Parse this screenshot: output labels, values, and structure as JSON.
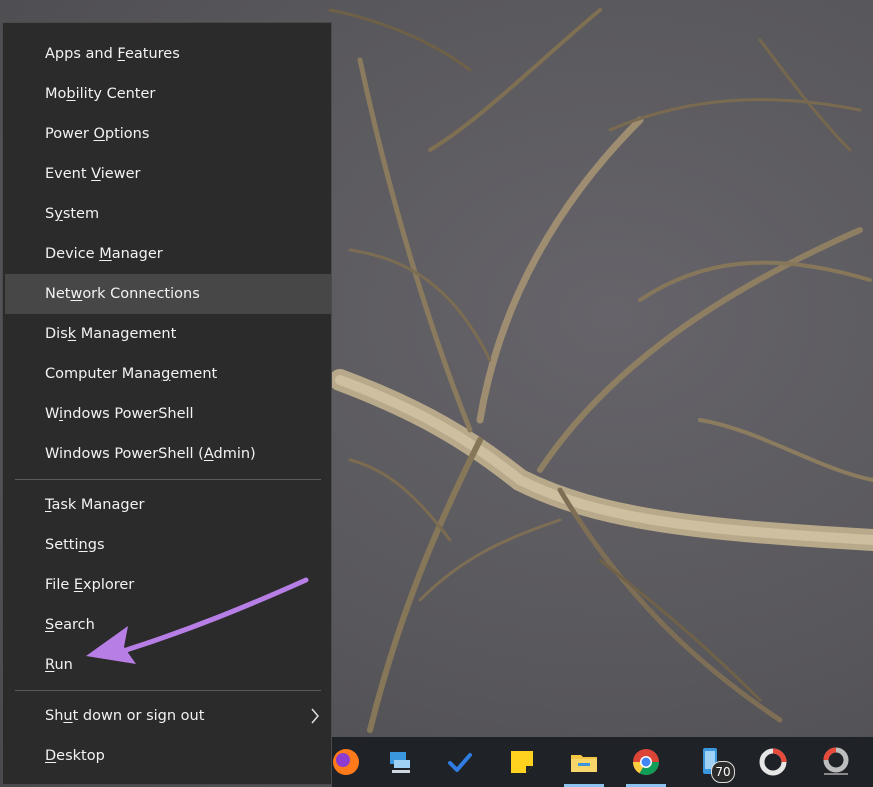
{
  "menu": {
    "items": [
      {
        "pre": "Apps and ",
        "u": "F",
        "post": "eatures"
      },
      {
        "pre": "Mo",
        "u": "b",
        "post": "ility Center"
      },
      {
        "pre": "Power ",
        "u": "O",
        "post": "ptions"
      },
      {
        "pre": "Event ",
        "u": "V",
        "post": "iewer"
      },
      {
        "pre": "S",
        "u": "y",
        "post": "stem"
      },
      {
        "pre": "Device ",
        "u": "M",
        "post": "anager"
      },
      {
        "pre": "Net",
        "u": "w",
        "post": "ork Connections"
      },
      {
        "pre": "Dis",
        "u": "k",
        "post": " Management"
      },
      {
        "pre": "Computer Mana",
        "u": "g",
        "post": "ement"
      },
      {
        "pre": "W",
        "u": "i",
        "post": "ndows PowerShell"
      },
      {
        "pre": "Windows PowerShell (",
        "u": "A",
        "post": "dmin)"
      },
      {
        "pre": "",
        "u": "T",
        "post": "ask Manager"
      },
      {
        "pre": "Setti",
        "u": "n",
        "post": "gs"
      },
      {
        "pre": "File ",
        "u": "E",
        "post": "xplorer"
      },
      {
        "pre": "",
        "u": "S",
        "post": "earch"
      },
      {
        "pre": "",
        "u": "R",
        "post": "un"
      },
      {
        "pre": "Sh",
        "u": "u",
        "post": "t down or sign out"
      },
      {
        "pre": "",
        "u": "D",
        "post": "esktop"
      }
    ],
    "hovered_item": "Network Connections",
    "submenu_icon": "chevron-right-icon"
  },
  "taskbar": {
    "icons": [
      "firefox-icon",
      "remote-desktop-icon",
      "todo-check-icon",
      "sticky-notes-icon",
      "file-explorer-icon",
      "chrome-icon",
      "phone-icon",
      "capture-app-icon",
      "photoscape-icon"
    ],
    "badge_count": "70"
  },
  "annotation": {
    "type": "arrow",
    "color": "#b77fe6",
    "points_to": "Run"
  }
}
